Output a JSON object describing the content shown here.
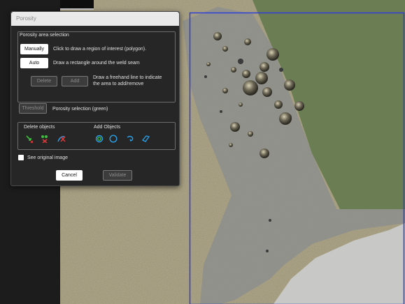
{
  "dialog": {
    "title": "Porosity"
  },
  "area_selection": {
    "title": "Porosity area selection",
    "manual_label": "Manually",
    "manual_desc": "Click to draw a region of interest (polygon).",
    "auto_label": "Auto",
    "auto_desc": "Draw a rectangle around the weld seam",
    "delete_label": "Delete",
    "add_label": "Add",
    "freehand_desc_1": "Draw a freehand line to indicate",
    "freehand_desc_2": "the area to add/remove"
  },
  "threshold": {
    "label": "Threshold",
    "desc": "Porosity selection (green)"
  },
  "objects": {
    "delete_title": "Delete objects",
    "add_title": "Add Objects",
    "delete_icons": [
      "point-delete-icon",
      "area-delete-icon",
      "brush-delete-icon"
    ],
    "add_icons": [
      "lasso-add-icon",
      "circle-add-icon",
      "freehand-add-icon",
      "polygon-add-icon"
    ]
  },
  "see_original": {
    "label": "See original image",
    "checked": false
  },
  "footer": {
    "cancel_label": "Cancel",
    "validate_label": "Validate"
  },
  "colors": {
    "selection_rect": "#2f3ed6",
    "icon_green": "#3fbf3f",
    "icon_blue": "#2aa0e8",
    "icon_red": "#e03a3a"
  }
}
